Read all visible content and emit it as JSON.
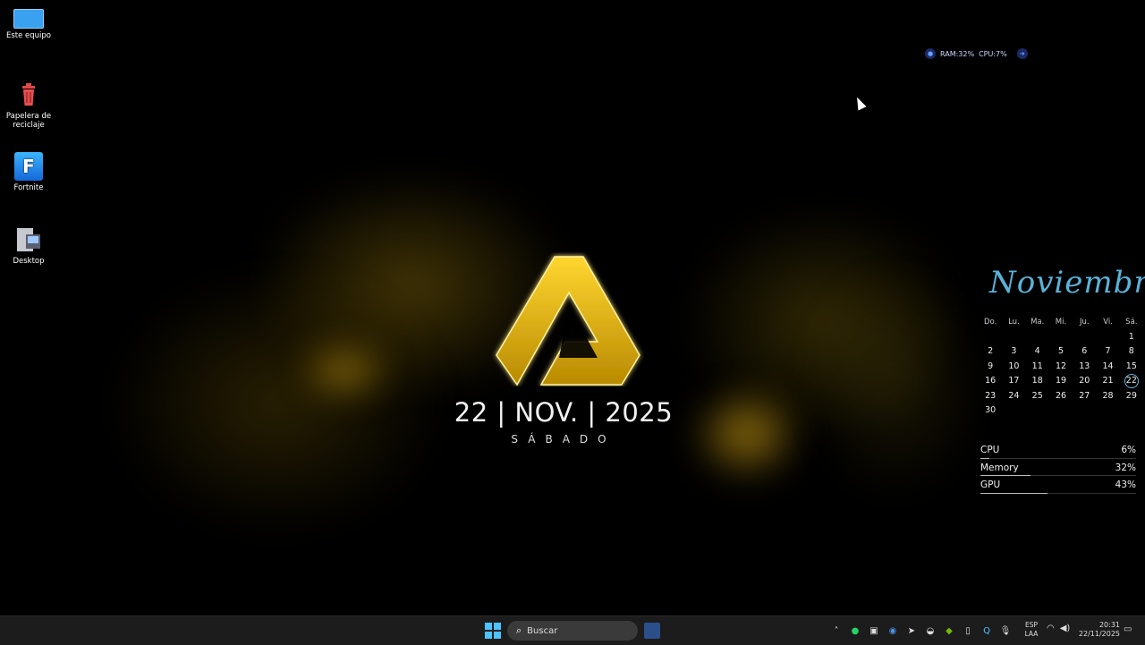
{
  "desktop_icons": [
    {
      "label": "Este equipo",
      "icon": "monitor-icon"
    },
    {
      "label": "Papelera de reciclaje",
      "icon": "recycle-bin-icon"
    },
    {
      "label": "Fortnite",
      "icon": "fortnite-icon"
    },
    {
      "label": "Desktop",
      "icon": "folder-icon"
    }
  ],
  "fortnite_glyph": "F",
  "wallpaper": {
    "date": "22 | NOV. | 2025",
    "day": "SÁBADO",
    "accent": "#f5c518"
  },
  "resource_widget": {
    "ram": "RAM:32%",
    "cpu": "CPU:7%"
  },
  "calendar": {
    "month": "Noviembre",
    "weekdays": [
      "Do.",
      "Lu.",
      "Ma.",
      "Mi.",
      "Ju.",
      "Vi.",
      "Sá."
    ],
    "weeks": [
      [
        "",
        "",
        "",
        "",
        "",
        "",
        "1"
      ],
      [
        "2",
        "3",
        "4",
        "5",
        "6",
        "7",
        "8"
      ],
      [
        "9",
        "10",
        "11",
        "12",
        "13",
        "14",
        "15"
      ],
      [
        "16",
        "17",
        "18",
        "19",
        "20",
        "21",
        "22"
      ],
      [
        "23",
        "24",
        "25",
        "26",
        "27",
        "28",
        "29"
      ],
      [
        "30",
        "",
        "",
        "",
        "",
        "",
        ""
      ]
    ],
    "today": "22",
    "accent": "#5ab2d8"
  },
  "stats": [
    {
      "label": "CPU",
      "value": "6%",
      "level": 0.06
    },
    {
      "label": "Memory",
      "value": "32%",
      "level": 0.32
    },
    {
      "label": "GPU",
      "value": "43%",
      "level": 0.43
    }
  ],
  "taskbar": {
    "search_placeholder": "Buscar",
    "lang_line1": "ESP",
    "lang_line2": "LAA",
    "time": "20:31",
    "date": "22/11/2025",
    "tray_icons": [
      "chevron-up-icon",
      "whatsapp-icon",
      "app-icon",
      "chrome-icon",
      "paperplane-icon",
      "discord-icon",
      "nvidia-icon",
      "battery-icon",
      "app-q-icon",
      "mic-icon"
    ]
  }
}
